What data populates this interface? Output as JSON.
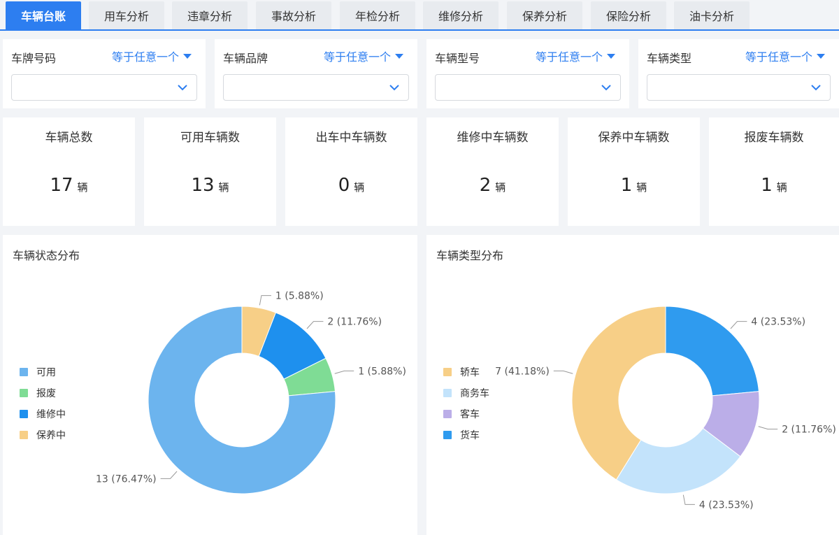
{
  "tabs": [
    {
      "label": "车辆台账",
      "active": true
    },
    {
      "label": "用车分析",
      "active": false
    },
    {
      "label": "违章分析",
      "active": false
    },
    {
      "label": "事故分析",
      "active": false
    },
    {
      "label": "年检分析",
      "active": false
    },
    {
      "label": "维修分析",
      "active": false
    },
    {
      "label": "保养分析",
      "active": false
    },
    {
      "label": "保险分析",
      "active": false
    },
    {
      "label": "油卡分析",
      "active": false
    }
  ],
  "filters": [
    {
      "label": "车牌号码",
      "operator": "等于任意一个",
      "value": ""
    },
    {
      "label": "车辆品牌",
      "operator": "等于任意一个",
      "value": ""
    },
    {
      "label": "车辆型号",
      "operator": "等于任意一个",
      "value": ""
    },
    {
      "label": "车辆类型",
      "operator": "等于任意一个",
      "value": ""
    }
  ],
  "kpis": [
    {
      "title": "车辆总数",
      "value": "17",
      "unit": "辆"
    },
    {
      "title": "可用车辆数",
      "value": "13",
      "unit": "辆"
    },
    {
      "title": "出车中车辆数",
      "value": "0",
      "unit": "辆"
    },
    {
      "title": "维修中车辆数",
      "value": "2",
      "unit": "辆"
    },
    {
      "title": "保养中车辆数",
      "value": "1",
      "unit": "辆"
    },
    {
      "title": "报废车辆数",
      "value": "1",
      "unit": "辆"
    }
  ],
  "colors": {
    "accent": "#2d7ef0",
    "status": {
      "可用": "#6cb4ee",
      "报废": "#7fdc95",
      "维修中": "#1e90ee",
      "保养中": "#f7cf87"
    },
    "type": {
      "轿车": "#f7cf87",
      "商务车": "#c3e3fb",
      "客车": "#bbaee8",
      "货车": "#2f9bef"
    }
  },
  "icons": {
    "dropdown": "caret-down-icon",
    "select": "chevron-down-icon"
  },
  "chart_data": [
    {
      "type": "pie",
      "title": "车辆状态分布",
      "donut": true,
      "legend_position": "left",
      "legend": [
        "可用",
        "报废",
        "维修中",
        "保养中"
      ],
      "slices": [
        {
          "name": "保养中",
          "value": 1,
          "label": "1 (5.88%)"
        },
        {
          "name": "维修中",
          "value": 2,
          "label": "2 (11.76%)"
        },
        {
          "name": "报废",
          "value": 1,
          "label": "1 (5.88%)"
        },
        {
          "name": "可用",
          "value": 13,
          "label": "13 (76.47%)"
        }
      ]
    },
    {
      "type": "pie",
      "title": "车辆类型分布",
      "donut": true,
      "legend_position": "left",
      "legend": [
        "轿车",
        "商务车",
        "客车",
        "货车"
      ],
      "slices": [
        {
          "name": "货车",
          "value": 4,
          "label": "4 (23.53%)"
        },
        {
          "name": "客车",
          "value": 2,
          "label": "2 (11.76%)"
        },
        {
          "name": "商务车",
          "value": 4,
          "label": "4 (23.53%)"
        },
        {
          "name": "轿车",
          "value": 7,
          "label": "7 (41.18%)"
        }
      ]
    }
  ]
}
